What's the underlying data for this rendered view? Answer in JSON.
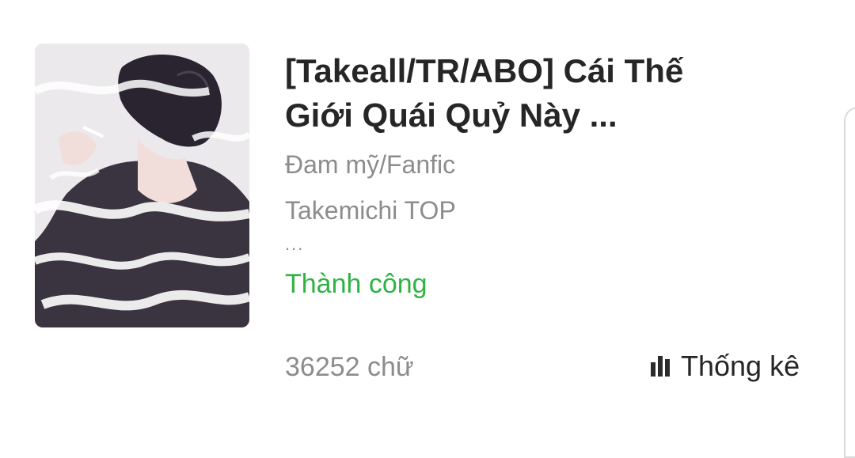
{
  "book": {
    "cover_image": "cover-illustration",
    "title": "[Takeall/TR/ABO] Cái Thế Giới Quái Quỷ Này ...",
    "category": "Đam mỹ/Fanfic",
    "tags": "Takemichi TOP",
    "more": "...",
    "status": "Thành công",
    "status_color": "#2fb344",
    "word_count": "36252 chữ"
  },
  "actions": {
    "stats_icon": "bar-chart-icon",
    "stats_label": "Thống kê"
  }
}
